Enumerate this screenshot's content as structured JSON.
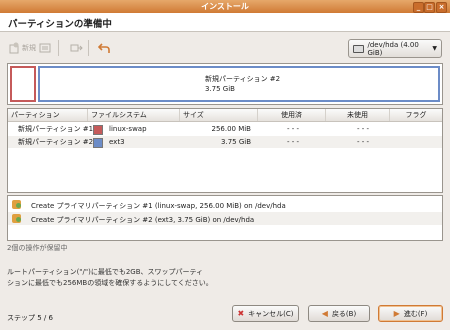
{
  "window": {
    "title": "インストール",
    "buttons": [
      "_",
      "□",
      "×"
    ]
  },
  "header": {
    "title": "パーティションの準備中"
  },
  "toolbar": {
    "new_label": "新規",
    "device_label": "/dev/hda  (4.00 GiB)",
    "icons": {
      "new": "new-partition-icon",
      "delete": "delete-icon",
      "resize": "resize-icon",
      "undo": "undo-icon"
    }
  },
  "partition_bar": {
    "ext3_name": "新規パーティション #2",
    "ext3_size": "3.75 GiB",
    "colors": {
      "swap": "#c55a5a",
      "ext3": "#6c8cc7"
    }
  },
  "table": {
    "columns": [
      "パーティション",
      "ファイルシステム",
      "サイズ",
      "使用済",
      "未使用",
      "フラグ"
    ],
    "rows": [
      {
        "partition": "新規パーティション #1",
        "fs": "linux-swap",
        "size": "256.00 MiB",
        "used": "- - -",
        "unused": "- - -",
        "color": "#c55a5a"
      },
      {
        "partition": "新規パーティション #2",
        "fs": "ext3",
        "size": "3.75 GiB",
        "used": "- - -",
        "unused": "- - -",
        "color": "#6c8cc7"
      }
    ]
  },
  "operations": [
    "Create プライマリパーティション #1 (linux-swap, 256.00 MiB) on /dev/hda",
    "Create プライマリパーティション #2 (ext3, 3.75 GiB) on /dev/hda"
  ],
  "pending": "2個の操作が保留中",
  "note": {
    "line1": "ルートパーティション(\"/\")に最低でも2GB、スワップパーティ",
    "line2": "ションに最低でも256MBの領域を確保するようにしてください。"
  },
  "footer": {
    "step": "ステップ 5 / 6",
    "cancel": "キャンセル(C)",
    "back": "戻る(B)",
    "forward": "進む(F)"
  }
}
